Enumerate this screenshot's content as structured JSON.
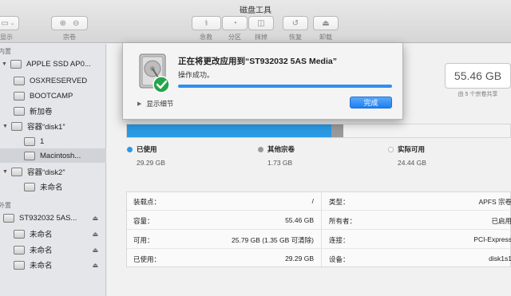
{
  "window": {
    "title": "磁盘工具"
  },
  "toolbar": {
    "display_label": "显示",
    "volume_label": "宗卷",
    "rescue_label": "急救",
    "partition_label": "分区",
    "erase_label": "抹掉",
    "restore_label": "恢复",
    "unmount_label": "卸载"
  },
  "sidebar": {
    "internal_header": "内置",
    "external_header": "外置",
    "items": [
      {
        "label": "APPLE SSD AP0..."
      },
      {
        "label": "OSXRESERVED"
      },
      {
        "label": "BOOTCAMP"
      },
      {
        "label": "新加卷"
      },
      {
        "label": "容器“disk1”"
      },
      {
        "label": "1"
      },
      {
        "label": "Macintosh..."
      },
      {
        "label": "容器“disk2”"
      },
      {
        "label": "未命名"
      },
      {
        "label": "ST932032 5AS..."
      },
      {
        "label": "未命名"
      },
      {
        "label": "未命名"
      },
      {
        "label": "未命名"
      }
    ]
  },
  "dialog": {
    "title": "正在将更改应用到“ST932032 5AS Media”",
    "message": "操作成功。",
    "progress": 1.0,
    "details_label": "显示细节",
    "done_label": "完成"
  },
  "capacity": {
    "value": "55.46 GB",
    "subtitle": "由 5 个宗卷共享"
  },
  "usage": {
    "used_fraction": 0.534,
    "other_fraction": 0.031,
    "used": {
      "label": "已使用",
      "value": "29.29 GB",
      "color": "#2a9ae5"
    },
    "other": {
      "label": "其他宗卷",
      "value": "1.73 GB",
      "color": "#9a9a9a"
    },
    "available": {
      "label": "实际可用",
      "value": "24.44 GB",
      "color": "#ffffff"
    }
  },
  "info": {
    "rows": [
      {
        "k1": "装载点：",
        "v1": "/",
        "k2": "类型：",
        "v2": "APFS 宗卷"
      },
      {
        "k1": "容量：",
        "v1": "55.46 GB",
        "k2": "所有者：",
        "v2": "已启用"
      },
      {
        "k1": "可用：",
        "v1": "25.79 GB (1.35 GB 可清除)",
        "k2": "连接：",
        "v2": "PCI-Express"
      },
      {
        "k1": "已使用：",
        "v1": "29.29 GB",
        "k2": "设备：",
        "v2": "disk1s1"
      }
    ]
  }
}
